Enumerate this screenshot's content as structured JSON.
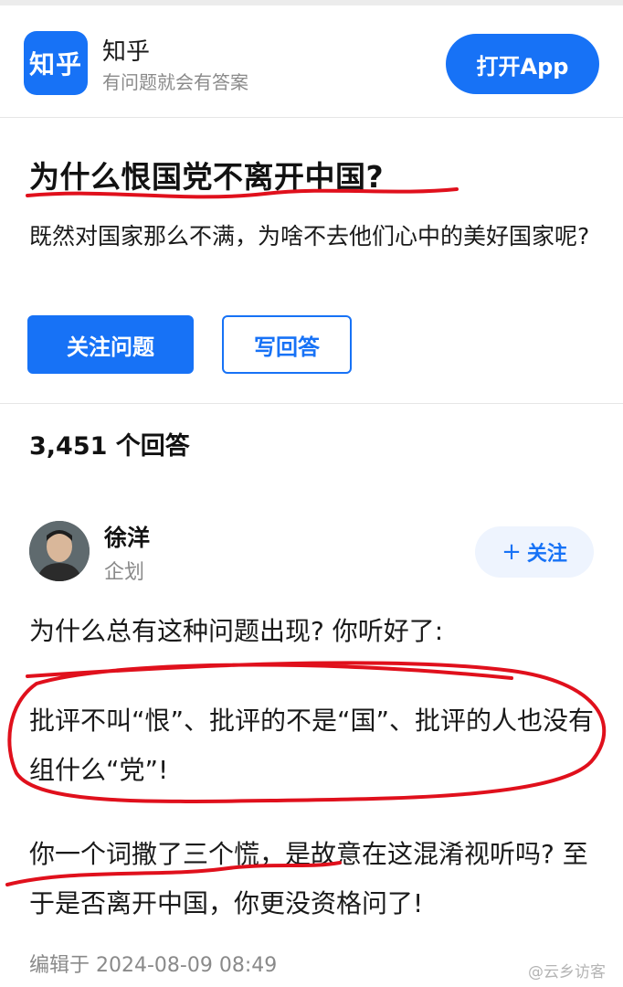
{
  "app_banner": {
    "logo_text": "知乎",
    "app_name": "知乎",
    "slogan": "有问题就会有答案",
    "open_app_label": "打开App"
  },
  "question": {
    "title": "为什么恨国党不离开中国?",
    "description": "既然对国家那么不满，为啥不去他们心中的美好国家呢?",
    "follow_label": "关注问题",
    "write_answer_label": "写回答"
  },
  "answers": {
    "count_label": "3,451 个回答"
  },
  "answer": {
    "author_name": "徐洋",
    "author_headline": "企划",
    "follow_plus": "+",
    "follow_label": "关注",
    "paragraphs": [
      "为什么总有这种问题出现? 你听好了:",
      "批评不叫“恨”、批评的不是“国”、批评的人也没有组什么“党”!",
      "你一个词撒了三个慌，是故意在这混淆视听吗? 至于是否离开中国，你更没资格问了!"
    ],
    "edited_label": "编辑于 2024-08-09 08:49"
  },
  "watermark": "@云乡访客",
  "colors": {
    "brand_blue": "#1772f6",
    "annotation_red": "#e0101c",
    "muted_gray": "#8a8a8a"
  }
}
